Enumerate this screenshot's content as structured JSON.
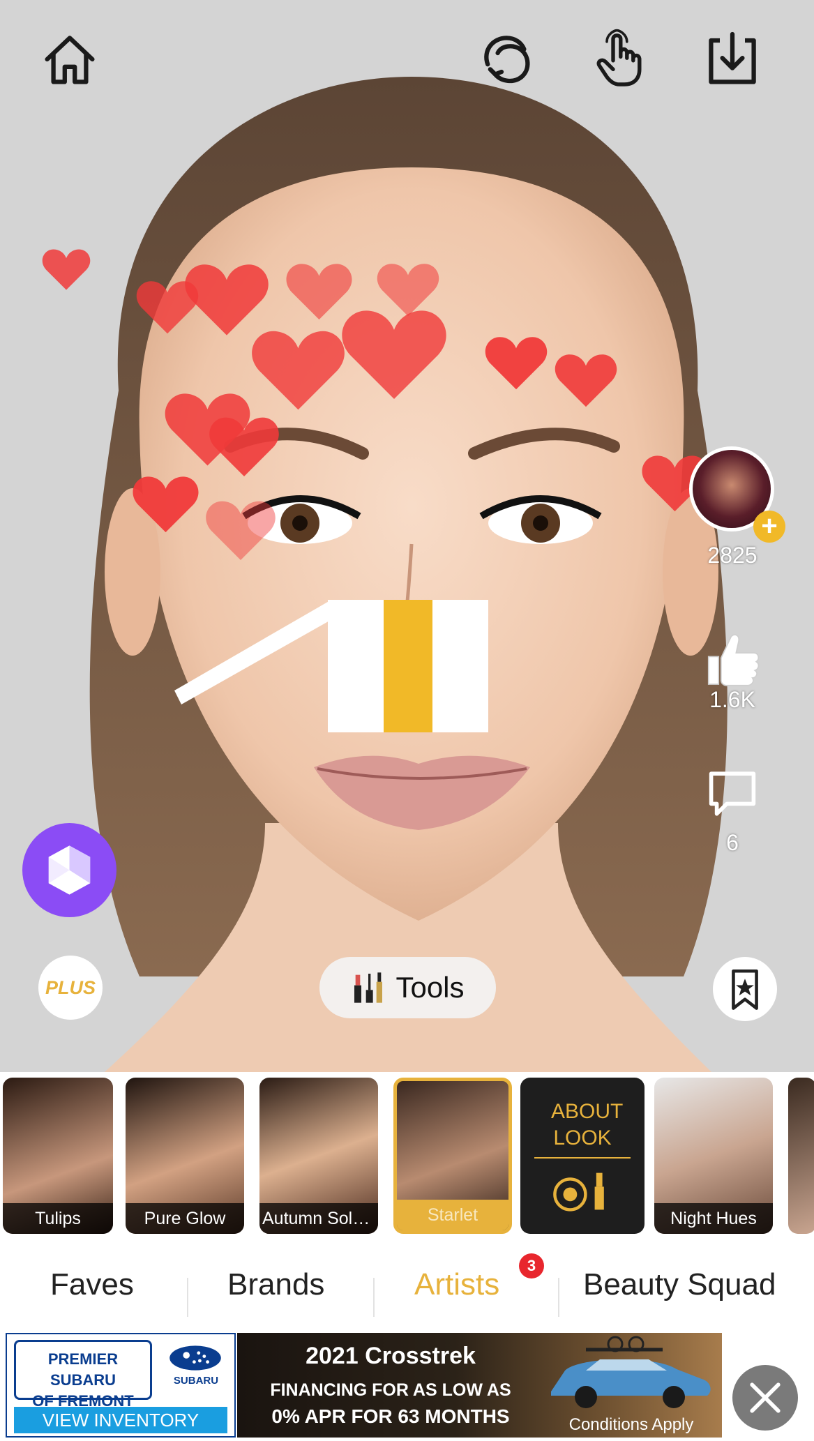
{
  "top_bar": {
    "icons": [
      "home-icon",
      "face-swap-icon",
      "touch-icon",
      "download-icon"
    ]
  },
  "artist": {
    "followers": "2825",
    "likes": "1.6K",
    "comments": "6"
  },
  "tools_button": {
    "label": "Tools"
  },
  "plus_badge": {
    "label": "PLUS"
  },
  "looks": [
    {
      "label": "Tulips"
    },
    {
      "label": "Pure Glow"
    },
    {
      "label": "Autumn Solst..."
    },
    {
      "label": "Starlet"
    },
    {
      "label": "ABOUT LOOK"
    },
    {
      "label": "Night Hues"
    }
  ],
  "tabs": [
    {
      "label": "Faves"
    },
    {
      "label": "Brands"
    },
    {
      "label": "Artists",
      "badge": "3"
    },
    {
      "label": "Beauty Squad"
    }
  ],
  "colors": {
    "accent_gold": "#e7b23c",
    "heart_red": "#f03a3a",
    "purple": "#8b4cf5",
    "tab_badge": "#e8262d"
  },
  "ad": {
    "dealer_line1": "PREMIER SUBARU",
    "dealer_line2": "OF FREMONT",
    "brand": "SUBARU",
    "cta": "VIEW INVENTORY",
    "headline": "2021 Crosstrek",
    "line1": "FINANCING FOR AS LOW AS",
    "line2": "0% APR FOR 63 MONTHS",
    "disclaimer": "Conditions Apply"
  }
}
